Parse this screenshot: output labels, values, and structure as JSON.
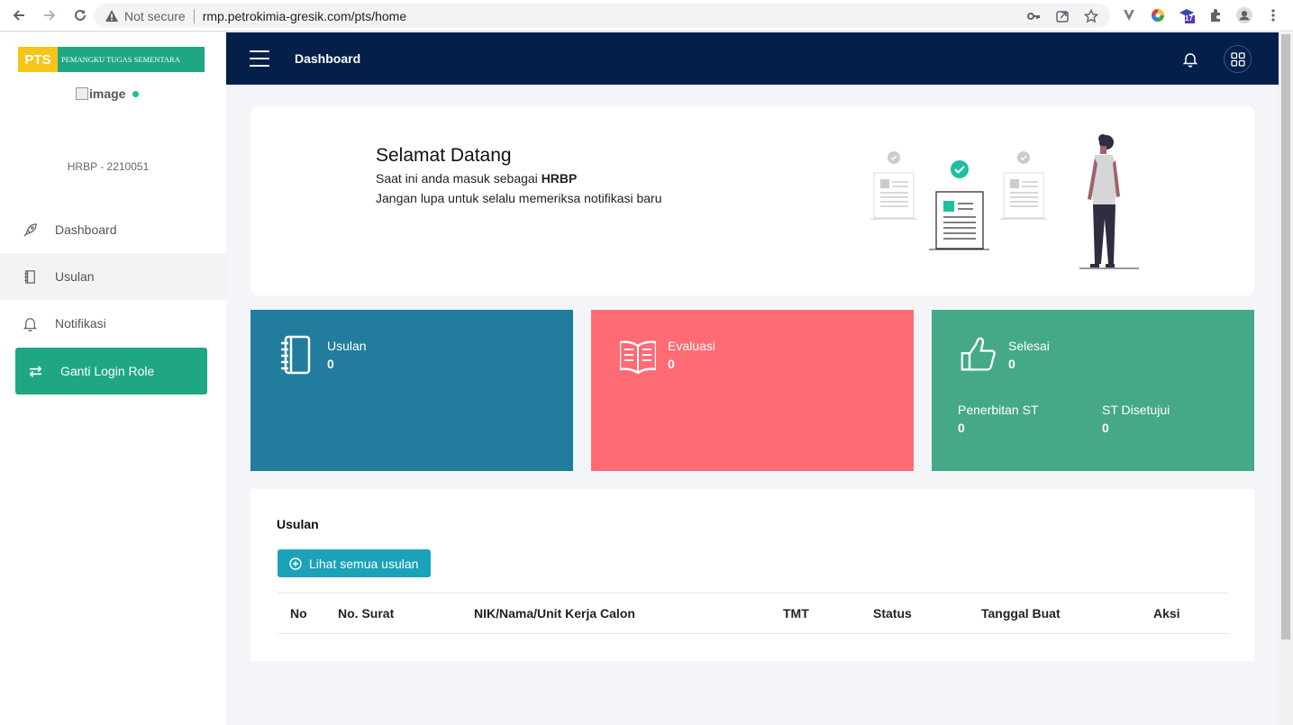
{
  "browser": {
    "security_label": "Not secure",
    "url": "rmp.petrokimia-gresik.com/pts/home",
    "ext_badge": "17"
  },
  "sidebar": {
    "brand_short": "PTS",
    "brand_full": "PEMANGKU TUGAS SEMENTARA",
    "avatar_alt": "image",
    "user": "HRBP - 2210051",
    "items": [
      {
        "label": "Dashboard",
        "icon": "rocket-icon"
      },
      {
        "label": "Usulan",
        "icon": "book-icon"
      },
      {
        "label": "Notifikasi",
        "icon": "bell-icon"
      }
    ],
    "role_button": "Ganti Login Role"
  },
  "topbar": {
    "title": "Dashboard"
  },
  "welcome": {
    "heading": "Selamat Datang",
    "line1_prefix": "Saat ini anda masuk sebagai ",
    "role": "HRBP",
    "line2": "Jangan lupa untuk selalu memeriksa notifikasi baru"
  },
  "stats": {
    "usulan": {
      "label": "Usulan",
      "value": "0"
    },
    "evaluasi": {
      "label": "Evaluasi",
      "value": "0"
    },
    "selesai": {
      "label": "Selesai",
      "value": "0"
    },
    "penerbitan": {
      "label": "Penerbitan ST",
      "value": "0"
    },
    "disetujui": {
      "label": "ST Disetujui",
      "value": "0"
    }
  },
  "usulan_table": {
    "title": "Usulan",
    "button": "Lihat semua usulan",
    "columns": [
      "No",
      "No. Surat",
      "NIK/Nama/Unit Kerja Calon",
      "TMT",
      "Status",
      "Tanggal Buat",
      "Aksi"
    ]
  },
  "colors": {
    "topbar": "#04204a",
    "accent_green": "#1fa784",
    "card_blue": "#217c9e",
    "card_red": "#fe6b73",
    "card_green": "#45a988",
    "button_teal": "#1ba2b9"
  }
}
